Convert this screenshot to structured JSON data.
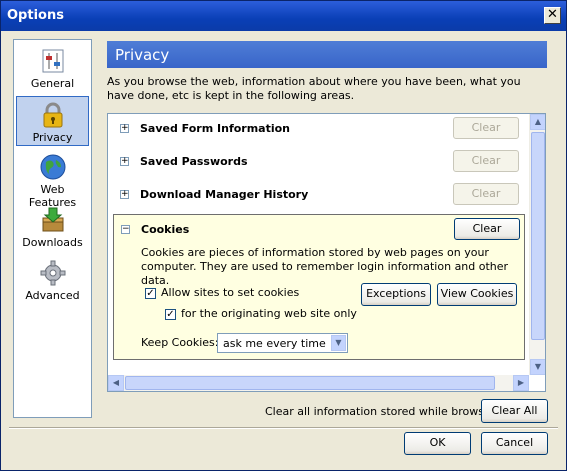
{
  "window": {
    "title": "Options"
  },
  "sidebar": {
    "items": [
      {
        "label": "General",
        "icon": "general-icon"
      },
      {
        "label": "Privacy",
        "icon": "lock-icon",
        "selected": true
      },
      {
        "label": "Web Features",
        "icon": "globe-icon"
      },
      {
        "label": "Downloads",
        "icon": "downloads-icon"
      },
      {
        "label": "Advanced",
        "icon": "gear-icon"
      }
    ]
  },
  "panel": {
    "title": "Privacy",
    "intro": "As you browse the web, information about where you have been, what you have done, etc is kept in the following areas."
  },
  "items": [
    {
      "title": "Saved Form Information",
      "button": "Clear",
      "enabled": false
    },
    {
      "title": "Saved Passwords",
      "button": "Clear",
      "enabled": false
    },
    {
      "title": "Download Manager History",
      "button": "Clear",
      "enabled": false
    }
  ],
  "cookies": {
    "title": "Cookies",
    "clear": "Clear",
    "description": "Cookies are pieces of information stored by web pages on your computer. They are used to remember login information and other data.",
    "allow_label": "Allow sites to set cookies",
    "allow_checked": true,
    "origin_label": "for the originating web site only",
    "origin_checked": true,
    "exceptions": "Exceptions",
    "view": "View Cookies",
    "keep_label": "Keep Cookies:",
    "keep_value": "ask me every time"
  },
  "footer": {
    "clear_all_label": "Clear all information stored while browsing:",
    "clear_all_button": "Clear All",
    "ok": "OK",
    "cancel": "Cancel"
  },
  "colors": {
    "titlebar": "#0A3FB6",
    "header": "#4271D0",
    "cookies_bg": "#FFFFE1",
    "selected": "#C1D2EE"
  }
}
